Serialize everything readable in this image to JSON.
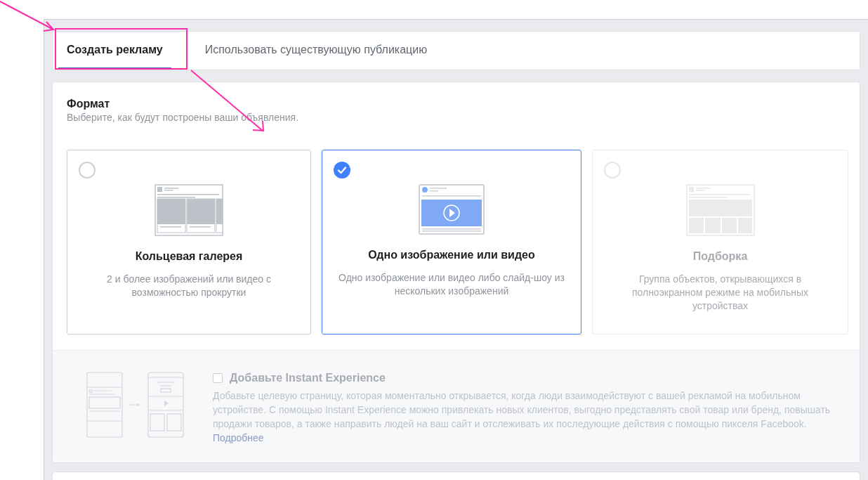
{
  "tabs": [
    {
      "label": "Создать рекламу",
      "selected": true
    },
    {
      "label": "Использовать существующую публикацию",
      "selected": false
    }
  ],
  "format": {
    "title": "Формат",
    "subtitle": "Выберите, как будут построены ваши объявления.",
    "options": [
      {
        "kind": "carousel",
        "title": "Кольцевая галерея",
        "description": "2 и более изображений или видео с возможностью прокрутки",
        "selected": false,
        "disabled": false
      },
      {
        "kind": "single",
        "title": "Одно изображение или видео",
        "description": "Одно изображение или видео либо слайд-шоу из нескольких изображений",
        "selected": true,
        "disabled": false
      },
      {
        "kind": "collection",
        "title": "Подборка",
        "description": "Группа объектов, открывающихся в полноэкранном режиме на мобильных устройствах",
        "selected": false,
        "disabled": true
      }
    ]
  },
  "instant_experience": {
    "title": "Добавьте Instant Experience",
    "checked": false,
    "disabled": true,
    "description": "Добавьте целевую страницу, которая моментально открывается, когда люди взаимодействуют с вашей рекламой на мобильном устройстве. С помощью Instant Experience можно привлекать новых клиентов, выгодно представлять свой товар или бренд, повышать продажи товаров, а также направить людей на ваш сайт и отслеживать их последующие действия с помощью пикселя Facebook.",
    "link": "Подробнее"
  }
}
